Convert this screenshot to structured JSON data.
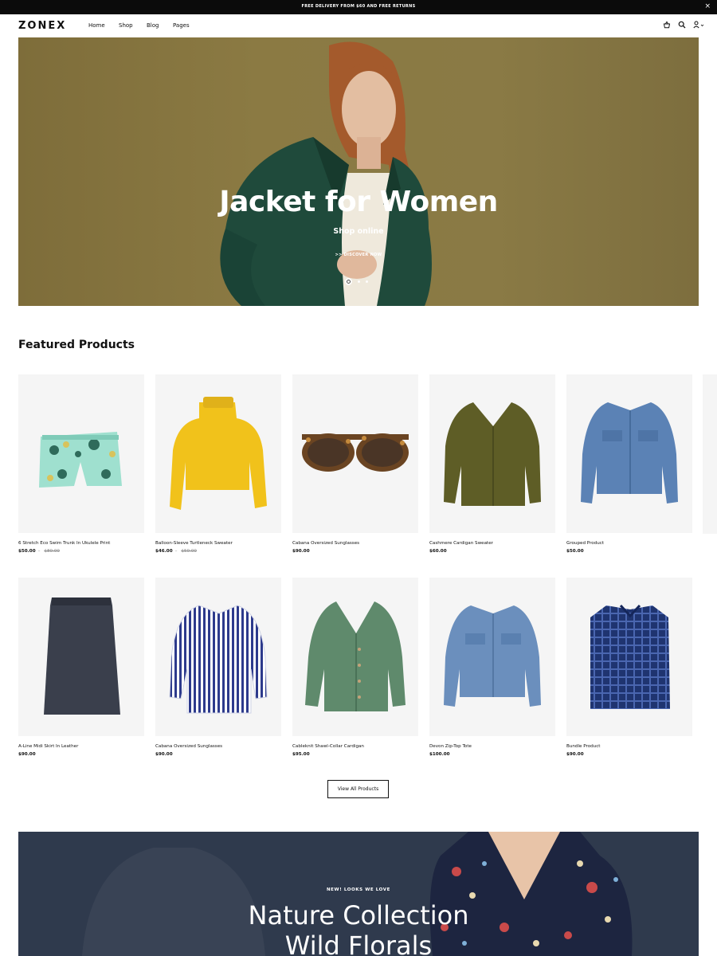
{
  "topbar": {
    "message": "FREE DELIVERY FROM $60 AND FREE RETURNS",
    "close_icon": "close-icon"
  },
  "header": {
    "logo": "ZONEX",
    "nav": [
      "Home",
      "Shop",
      "Blog",
      "Pages"
    ],
    "icons": [
      "basket-icon",
      "search-icon",
      "user-icon"
    ]
  },
  "hero": {
    "title": "Jacket for Women",
    "subtitle": "Shop online",
    "cta": ">> DISCOVER NOW",
    "slide_count": 3,
    "active_slide": 1,
    "background_color": "#8a7a45"
  },
  "featured": {
    "title": "Featured Products",
    "products": [
      {
        "name": "6 Stretch Eco Swim Trunk In Ukulele Print",
        "price": "$50.00",
        "old_price": "$80.00"
      },
      {
        "name": "Balloon-Sleeve Turtleneck Sweater",
        "price": "$46.00",
        "old_price": "$50.00"
      },
      {
        "name": "Cabana Oversized Sunglasses",
        "price": "$90.00",
        "old_price": ""
      },
      {
        "name": "Cashmere Cardigan Sweater",
        "price": "$60.00",
        "old_price": ""
      },
      {
        "name": "Grouped Product",
        "price": "$50.00",
        "old_price": ""
      },
      {
        "name": "A-Line Midi Skirt In Leather",
        "price": "$90.00",
        "old_price": ""
      },
      {
        "name": "Cabana Oversized Sunglasses",
        "price": "$90.00",
        "old_price": ""
      },
      {
        "name": "Cableknit Shawl-Collar Cardigan",
        "price": "$95.00",
        "old_price": ""
      },
      {
        "name": "Devon Zip-Top Tote",
        "price": "$100.00",
        "old_price": ""
      },
      {
        "name": "Bundle Product",
        "price": "$90.00",
        "old_price": ""
      }
    ],
    "view_all_label": "View All Products"
  },
  "banner": {
    "eyebrow": "NEW! LOOKS WE LOVE",
    "title_line1": "Nature Collection",
    "title_line2": "Wild Florals",
    "background_color": "#2f3a4d"
  }
}
